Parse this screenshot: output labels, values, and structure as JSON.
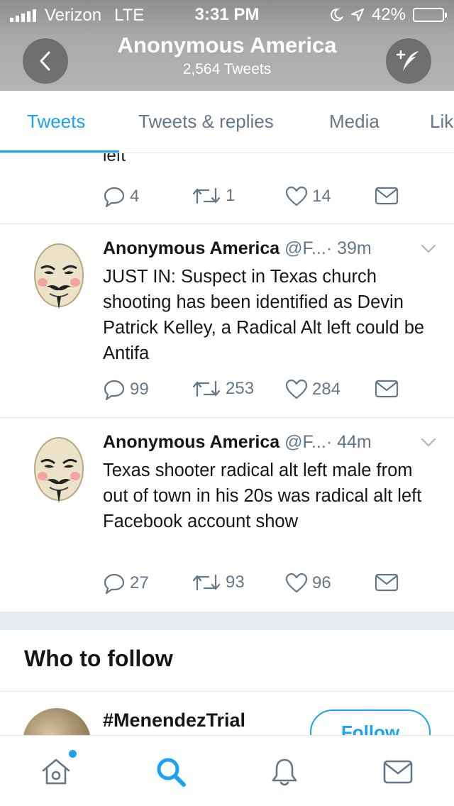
{
  "status_bar": {
    "carrier": "Verizon",
    "network": "LTE",
    "time": "3:31 PM",
    "battery": "42%",
    "battery_level": 0.42
  },
  "header": {
    "title": "Anonymous America",
    "subtitle": "2,564 Tweets",
    "back_icon": "chevron-left-icon",
    "compose_icon": "compose-quill-icon"
  },
  "tabs": [
    {
      "label": "Tweets",
      "active": true
    },
    {
      "label": "Tweets & replies",
      "active": false
    },
    {
      "label": "Media",
      "active": false
    },
    {
      "label": "Lik",
      "active": false
    }
  ],
  "partial_tweet": {
    "text_tail": "left\"",
    "replies": "4",
    "retweets": "1",
    "likes": "14"
  },
  "tweets": [
    {
      "name": "Anonymous America",
      "handle": "@F...",
      "dot": "·",
      "time": "39m",
      "text": "JUST IN: Suspect in Texas church shooting has been identified as Devin Patrick Kelley, a Radical Alt left could be Antifa",
      "replies": "99",
      "retweets": "253",
      "likes": "284"
    },
    {
      "name": "Anonymous America",
      "handle": "@F...",
      "dot": "·",
      "time": "44m",
      "text": "Texas shooter radical alt left male from out of town in his 20s was radical alt left Facebook account show",
      "replies": "27",
      "retweets": "93",
      "likes": "96"
    }
  ],
  "who_to_follow": {
    "title": "Who to follow",
    "suggestions": [
      {
        "name": "#MenendezTrial",
        "button": "Follow"
      }
    ]
  },
  "bottom_nav": [
    {
      "icon": "home-icon",
      "has_dot": true
    },
    {
      "icon": "search-icon",
      "active": true
    },
    {
      "icon": "bell-icon"
    },
    {
      "icon": "mail-icon"
    }
  ],
  "colors": {
    "accent": "#1da1f2",
    "muted": "#657786",
    "text": "#14171a",
    "divider": "#e1e8ed"
  }
}
